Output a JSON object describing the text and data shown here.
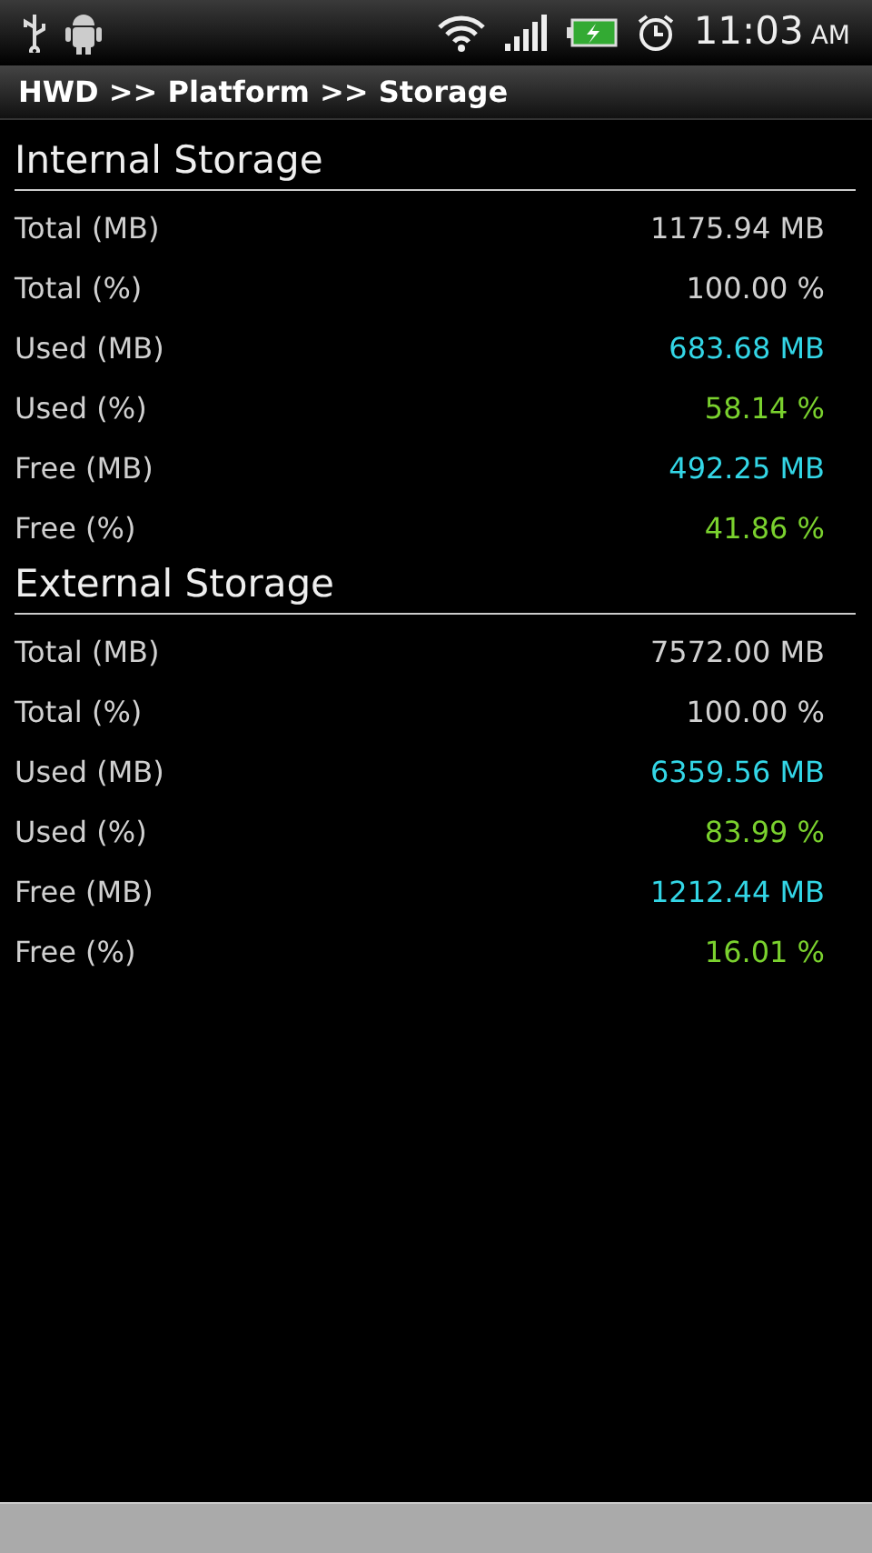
{
  "status_bar": {
    "time": "11:03",
    "ampm": "AM"
  },
  "title": "HWD >> Platform >> Storage",
  "sections": [
    {
      "heading": "Internal Storage",
      "rows": [
        {
          "label": "Total (MB)",
          "value": "1175.94 MB",
          "color": "#d0d0d0"
        },
        {
          "label": "Total (%)",
          "value": "100.00 %",
          "color": "#d0d0d0"
        },
        {
          "label": "Used (MB)",
          "value": "683.68 MB",
          "color": "#33d6e6"
        },
        {
          "label": "Used (%)",
          "value": "58.14 %",
          "color": "#7ad12e"
        },
        {
          "label": "Free (MB)",
          "value": "492.25 MB",
          "color": "#33d6e6"
        },
        {
          "label": "Free (%)",
          "value": "41.86 %",
          "color": "#7ad12e"
        }
      ]
    },
    {
      "heading": "External Storage",
      "rows": [
        {
          "label": "Total (MB)",
          "value": "7572.00 MB",
          "color": "#d0d0d0"
        },
        {
          "label": "Total (%)",
          "value": "100.00 %",
          "color": "#d0d0d0"
        },
        {
          "label": "Used (MB)",
          "value": "6359.56 MB",
          "color": "#33d6e6"
        },
        {
          "label": "Used (%)",
          "value": "83.99 %",
          "color": "#7ad12e"
        },
        {
          "label": "Free (MB)",
          "value": "1212.44 MB",
          "color": "#33d6e6"
        },
        {
          "label": "Free (%)",
          "value": "16.01 %",
          "color": "#7ad12e"
        }
      ]
    }
  ]
}
